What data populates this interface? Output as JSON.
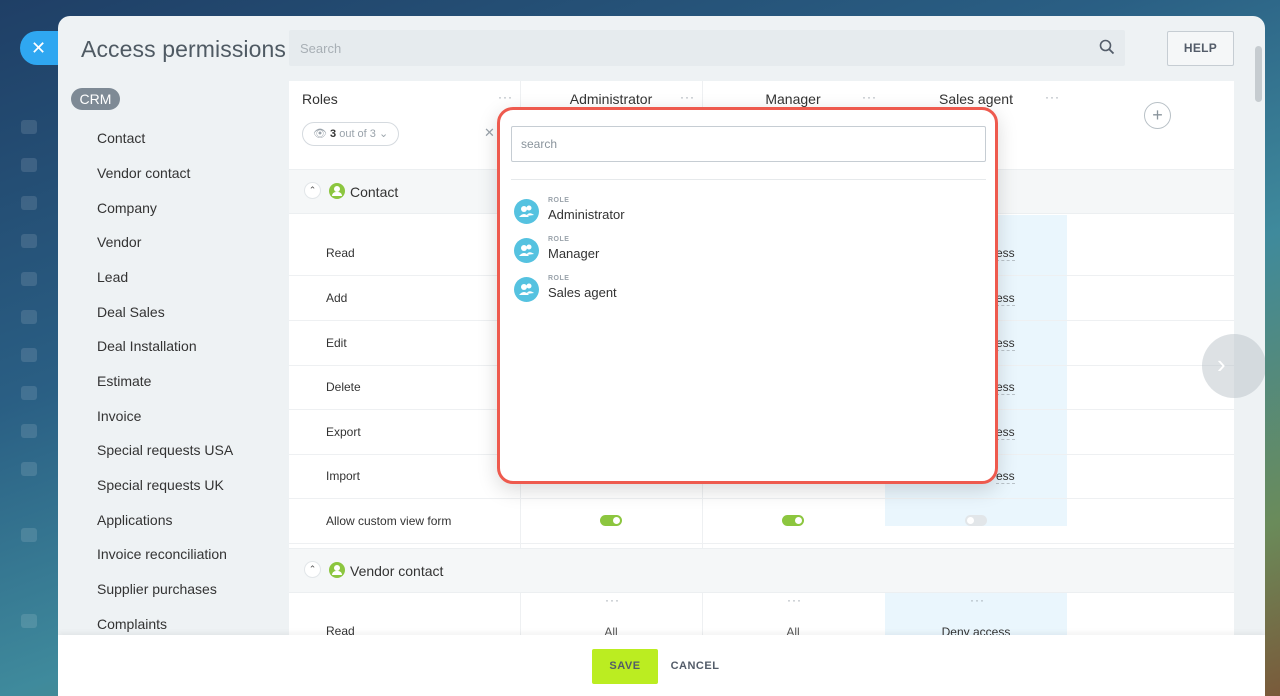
{
  "window": {
    "title": "Access permissions",
    "close_icon": "close-icon"
  },
  "search": {
    "placeholder": "Search"
  },
  "help": {
    "label": "HELP"
  },
  "sidebar": {
    "group": "CRM",
    "items": [
      "Contact",
      "Vendor contact",
      "Company",
      "Vendor",
      "Lead",
      "Deal Sales",
      "Deal Installation",
      "Estimate",
      "Invoice",
      "Special requests USA",
      "Special requests UK",
      "Applications",
      "Invoice reconciliation",
      "Supplier purchases",
      "Complaints"
    ]
  },
  "table": {
    "roles_header": "Roles",
    "counter": {
      "shown": "3",
      "text": " out of 3"
    },
    "columns": [
      "Administrator",
      "Manager",
      "Sales agent"
    ],
    "sections": [
      {
        "title": "Contact",
        "rows": [
          "Read",
          "Add",
          "Edit",
          "Delete",
          "Export",
          "Import",
          "Allow custom view form"
        ],
        "sales_agent_partial": [
          "ess",
          "ess",
          "ess",
          "ess",
          "ess",
          "ess"
        ]
      },
      {
        "title": "Vendor contact",
        "rows": [
          "Read"
        ],
        "values": {
          "administrator": "All",
          "manager": "All",
          "sales_agent": "Deny access"
        }
      }
    ]
  },
  "popup": {
    "search_placeholder": "search",
    "kicker": "ROLE",
    "roles": [
      "Administrator",
      "Manager",
      "Sales agent"
    ]
  },
  "footer": {
    "save": "SAVE",
    "cancel": "CANCEL"
  },
  "colors": {
    "accent": "#2fa7f1",
    "save": "#bbed21",
    "highlight_border": "#ee5a4e",
    "toggle_on": "#8cc63f",
    "role_avatar": "#55c2e0"
  }
}
